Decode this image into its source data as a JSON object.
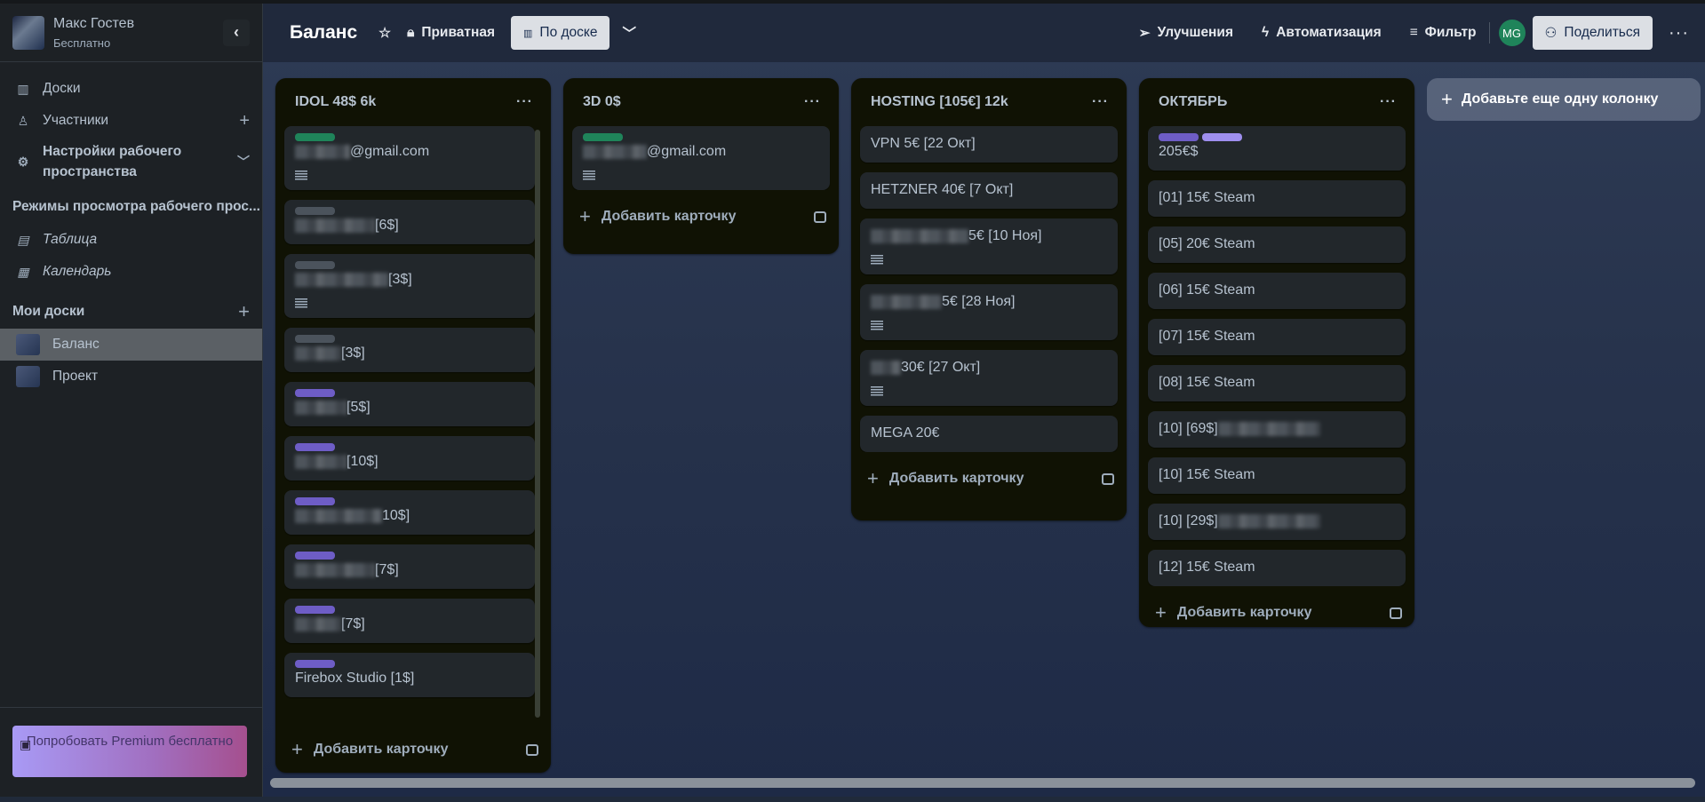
{
  "sidebar": {
    "user_name": "Макс Гостев",
    "plan": "Бесплатно",
    "nav": [
      {
        "label": "Доски",
        "icon": "board-icon"
      },
      {
        "label": "Участники",
        "icon": "user-icon"
      },
      {
        "label": "Настройки рабочего пространства",
        "icon": "gear-icon"
      }
    ],
    "views_title": "Режимы просмотра рабочего прос...",
    "views": [
      {
        "label": "Таблица",
        "icon": "table-icon"
      },
      {
        "label": "Календарь",
        "icon": "calendar-icon"
      }
    ],
    "boards_title": "Мои доски",
    "boards": [
      {
        "label": "Баланс",
        "active": true
      },
      {
        "label": "Проект",
        "active": false
      }
    ],
    "premium": "Попробовать Premium бесплатно"
  },
  "header": {
    "title": "Баланс",
    "visibility": "Приватная",
    "view": "По доске",
    "powerups": "Улучшения",
    "automation": "Автоматизация",
    "filter": "Фильтр",
    "avatar": "MG",
    "share": "Поделиться"
  },
  "colors": {
    "green": "#1f845a",
    "gray": "#4b535c",
    "purple": "#6e5dc6",
    "lightpurple": "#9f8fef"
  },
  "add_card": "Добавить карточку",
  "add_column": "Добавьте еще одну колонку",
  "columns": [
    {
      "title": "IDOL 48$ 6k",
      "cards": [
        {
          "labels": [
            "green"
          ],
          "redact": "pre",
          "text": "@gmail.com",
          "desc": true
        },
        {
          "labels": [
            "gray"
          ],
          "redact": "pre",
          "text": "[6$]"
        },
        {
          "labels": [
            "gray"
          ],
          "redact": "pre",
          "text": "[3$]",
          "desc": true
        },
        {
          "labels": [
            "gray"
          ],
          "redact": "pre",
          "text": "[3$]"
        },
        {
          "labels": [
            "purple"
          ],
          "redact": "pre",
          "text": "[5$]"
        },
        {
          "labels": [
            "purple"
          ],
          "redact": "pre",
          "text": "[10$]"
        },
        {
          "labels": [
            "purple"
          ],
          "redact": "pre",
          "text": "10$]"
        },
        {
          "labels": [
            "purple"
          ],
          "redact": "pre",
          "text": "[7$]"
        },
        {
          "labels": [
            "purple"
          ],
          "redact": "pre",
          "text": "[7$]"
        },
        {
          "labels": [
            "purple"
          ],
          "text": "Firebox Studio [1$]"
        }
      ]
    },
    {
      "title": "3D 0$",
      "cards": [
        {
          "labels": [
            "green"
          ],
          "redact": "pre",
          "text": "@gmail.com",
          "desc": true
        }
      ]
    },
    {
      "title": "HOSTING [105€] 12k",
      "cards": [
        {
          "text": "VPN 5€ [22 Окт]"
        },
        {
          "text": "HETZNER 40€ [7 Окт]"
        },
        {
          "redact": "pre",
          "text": "5€ [10 Ноя]",
          "desc": true
        },
        {
          "redact": "pre",
          "text": "5€ [28 Ноя]",
          "desc": true
        },
        {
          "redact": "pre",
          "text": "30€ [27 Окт]",
          "desc": true
        },
        {
          "text": "MEGA 20€"
        }
      ]
    },
    {
      "title": "ОКТЯБРЬ",
      "cards": [
        {
          "labels": [
            "purple",
            "lightpurple"
          ],
          "text": "205€$"
        },
        {
          "text": "[01] 15€ Steam"
        },
        {
          "text": "[05] 20€ Steam"
        },
        {
          "text": "[06] 15€ Steam"
        },
        {
          "text": "[07] 15€ Steam"
        },
        {
          "text": "[08] 15€ Steam"
        },
        {
          "redact": "post",
          "text": "[10] [69$]"
        },
        {
          "text": "[10] 15€ Steam"
        },
        {
          "redact": "post",
          "text": "[10] [29$]"
        },
        {
          "text": "[12] 15€ Steam"
        }
      ]
    }
  ]
}
